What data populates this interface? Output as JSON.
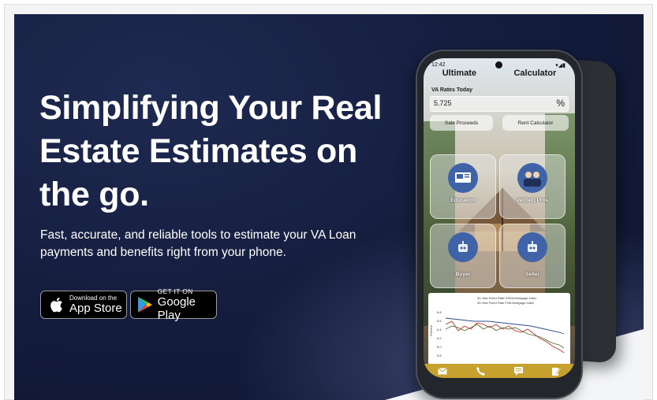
{
  "hero": {
    "headline": "Simplifying Your Real Estate Estimates on the go.",
    "subtext": "Fast, accurate, and reliable tools to estimate your VA Loan payments and benefits right from your phone."
  },
  "badges": {
    "apple": {
      "small": "Download on the",
      "big": "App Store",
      "icon": "apple-icon"
    },
    "google": {
      "small": "GET IT ON",
      "big": "Google Play",
      "icon": "google-play-icon"
    }
  },
  "phone": {
    "status_time": "12:42",
    "status_right": "▾◢▮",
    "app_title_left": "Ultimate",
    "app_title_right": "Calculator",
    "rates_label": "VA Rates Today",
    "rate_value": "5.725",
    "rate_unit": "%",
    "pills": [
      "Sale Proceeds",
      "Rent Calculator"
    ],
    "tiles": [
      "Education",
      "Vet(ted) Pros",
      "Buyer",
      "Seller"
    ],
    "chart_legend": [
      "30-Year Fixed Rate USDA Mortgage Index",
      "30-Year Fixed Rate FHA Mortgage Index"
    ],
    "chart_ylabel": "Percent",
    "chart_ticks": [
      "6.8",
      "6.6",
      "6.4",
      "6.2",
      "6.0",
      "5.8"
    ],
    "bottom_icons": [
      "mail-icon",
      "phone-icon",
      "chat-icon",
      "edit-icon"
    ]
  },
  "colors": {
    "hero_bg": "#141c3c",
    "tile_circle": "#3f63a6",
    "bottom_bar": "#c6a12d"
  }
}
